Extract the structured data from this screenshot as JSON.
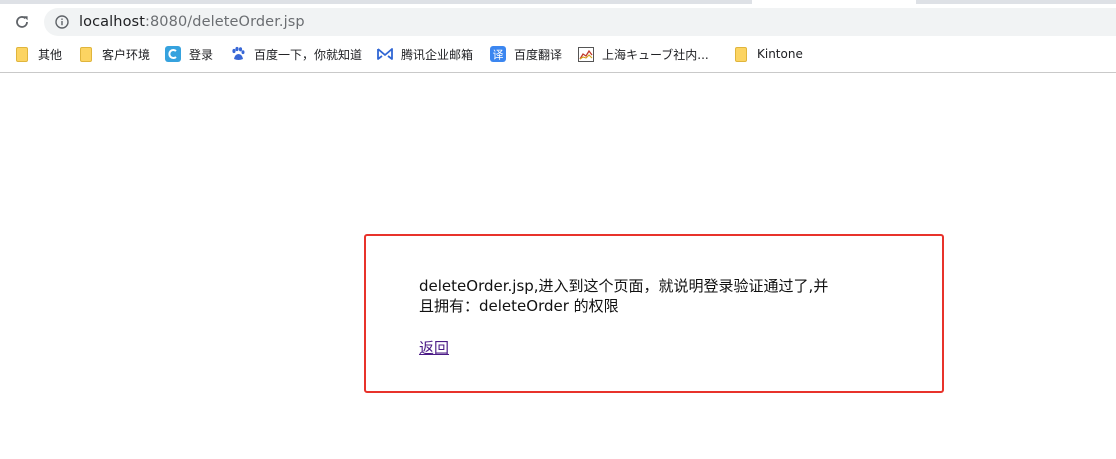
{
  "browser": {
    "url_host": "localhost",
    "url_rest": ":8080/deleteOrder.jsp",
    "bookmarks": [
      {
        "label": "其他",
        "icon": "folder-icon"
      },
      {
        "label": "客户环境",
        "icon": "folder-icon"
      },
      {
        "label": "登录",
        "icon": "c-logo-icon"
      },
      {
        "label": "百度一下，你就知道",
        "icon": "baidu-paw-icon"
      },
      {
        "label": "腾讯企业邮箱",
        "icon": "tencent-mail-icon"
      },
      {
        "label": "百度翻译",
        "icon": "baidu-translate-icon"
      },
      {
        "label": "上海キューブ社内...",
        "icon": "chart-image-icon"
      },
      {
        "label": "Kintone",
        "icon": "folder-icon"
      }
    ],
    "colors": {
      "folder": "#fcd462",
      "c_logo": "#36a2de",
      "baidu_paw": "#3867d6",
      "tencent_mail": "#3066d4",
      "baidu_translate": "#3b86f0"
    }
  },
  "page": {
    "message": "deleteOrder.jsp,进入到这个页面，就说明登录验证通过了,并且拥有：deleteOrder 的权限",
    "back_link": "返回",
    "border_color": "#e8322b"
  }
}
